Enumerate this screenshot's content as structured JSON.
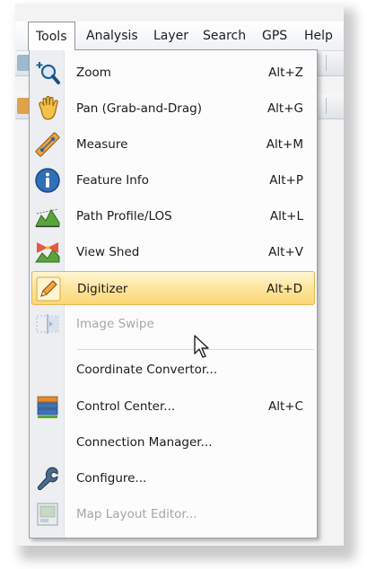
{
  "menubar": {
    "items": [
      {
        "label": "Tools",
        "active": true
      },
      {
        "label": "Analysis"
      },
      {
        "label": "Layer"
      },
      {
        "label": "Search"
      },
      {
        "label": "GPS"
      },
      {
        "label": "Help"
      }
    ]
  },
  "tools_menu": {
    "items": [
      {
        "label": "Zoom",
        "shortcut": "Alt+Z",
        "icon": "zoom-icon"
      },
      {
        "label": "Pan (Grab-and-Drag)",
        "shortcut": "Alt+G",
        "icon": "hand-icon"
      },
      {
        "label": "Measure",
        "shortcut": "Alt+M",
        "icon": "ruler-icon"
      },
      {
        "label": "Feature Info",
        "shortcut": "Alt+P",
        "icon": "info-icon"
      },
      {
        "label": "Path Profile/LOS",
        "shortcut": "Alt+L",
        "icon": "terrain-profile-icon"
      },
      {
        "label": "View Shed",
        "shortcut": "Alt+V",
        "icon": "view-shed-icon"
      },
      {
        "label": "Digitizer",
        "shortcut": "Alt+D",
        "icon": "pencil-icon",
        "highlighted": true
      },
      {
        "label": "Image Swipe",
        "shortcut": "",
        "icon": "image-swipe-icon",
        "disabled": true
      },
      {
        "label": "Coordinate Convertor...",
        "shortcut": ""
      },
      {
        "label": "Control Center...",
        "shortcut": "Alt+C",
        "icon": "control-center-icon"
      },
      {
        "label": "Connection Manager...",
        "shortcut": ""
      },
      {
        "label": "Configure...",
        "shortcut": "",
        "icon": "wrench-icon"
      },
      {
        "label": "Map Layout Editor...",
        "shortcut": "",
        "icon": "map-layout-icon",
        "disabled": true
      }
    ]
  },
  "colors": {
    "highlight_top": "#fff6d2",
    "highlight_bottom": "#fbd773",
    "highlight_border": "#e5b654",
    "disabled_text": "#a7a7a7",
    "gutter": "#eceef1"
  }
}
